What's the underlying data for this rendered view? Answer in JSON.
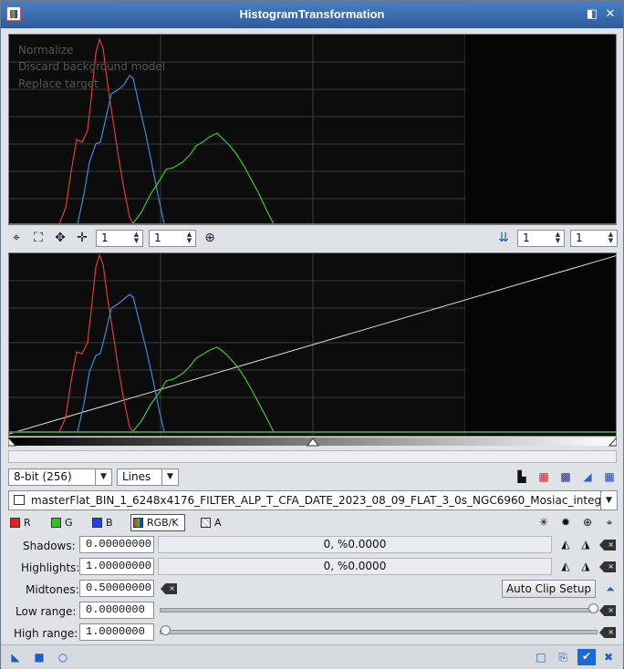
{
  "window": {
    "title": "HistogramTransformation",
    "close_glyph": "✕",
    "pin_glyph": "◧",
    "shade_glyph": "✕"
  },
  "toolbar": {
    "zoom_x": "1",
    "zoom_y": "1",
    "output_zoom_x": "1",
    "output_zoom_y": "1"
  },
  "histogram_options": {
    "resolution": "8-bit (256)",
    "graph_style": "Lines"
  },
  "view_selector": {
    "value": "masterFlat_BIN_1_6248x4176_FILTER_ALP_T_CFA_DATE_2023_08_09_FLAT_3_0s_NGC6960_Mosiac_integ"
  },
  "channels": {
    "r": "R",
    "g": "G",
    "b": "B",
    "rgbk": "RGB/K",
    "a": "A",
    "colors": {
      "r": "#e62020",
      "g": "#22cc22",
      "b": "#2244ee"
    }
  },
  "params": {
    "shadows_label": "Shadows:",
    "shadows_value": "0.00000000",
    "shadows_clip": "0, %0.0000",
    "highlights_label": "Highlights:",
    "highlights_value": "1.00000000",
    "highlights_clip": "0, %0.0000",
    "midtones_label": "Midtones:",
    "midtones_value": "0.50000000",
    "auto_clip_label": "Auto Clip Setup",
    "low_range_label": "Low range:",
    "low_range_value": "0.0000000",
    "low_range_level": 1.0,
    "high_range_label": "High range:",
    "high_range_value": "1.0000000",
    "high_range_level": 0.0
  },
  "background_text": {
    "normalize": "Normalize",
    "discard": "Discard background model",
    "replace": "Replace target"
  },
  "icons": {
    "zoom_fit": "arrows-icon",
    "zoom_in": "magnifier-icon",
    "output_toggle": "chevron-double-down-icon",
    "new_instance": "triangle-icon",
    "apply_global": "square-icon",
    "real_time": "circle-icon",
    "apply": "check-icon",
    "reset": "x-icon"
  }
}
